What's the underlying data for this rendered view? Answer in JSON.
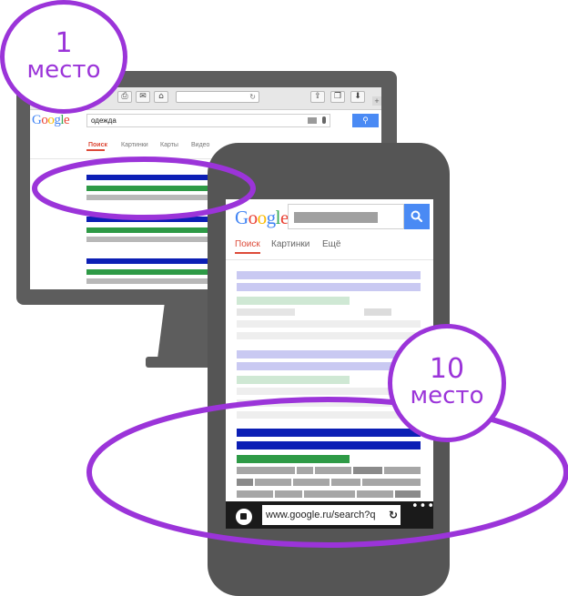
{
  "colors": {
    "accent_purple": "#9b34d9",
    "result_title": "#0c1fb5",
    "result_url": "#2e9a46",
    "search_blue": "#4a8af4",
    "device_gray": "#5d5d5d"
  },
  "desktop": {
    "logo_letters": [
      "G",
      "o",
      "o",
      "g",
      "l",
      "e"
    ],
    "logo_colors": [
      "#4285f4",
      "#ea4335",
      "#fbbc05",
      "#4285f4",
      "#34a853",
      "#ea4335"
    ],
    "query": "одежда",
    "search_icon": "search-icon",
    "toolbar_icons": [
      "printer-icon",
      "mail-icon",
      "home-icon"
    ],
    "toolbar_glyphs": [
      "⎙",
      "✉",
      "⌂"
    ],
    "right_icons": [
      "share-icon",
      "tabs-icon",
      "download-icon"
    ],
    "right_glyphs": [
      "⇪",
      "❐",
      "⬇"
    ],
    "reload_glyph": "↻",
    "plus_glyph": "+",
    "search_glyph": "⚲",
    "nav": [
      "Поиск",
      "Картинки",
      "Карты",
      "Видео"
    ]
  },
  "mobile": {
    "logo_letters": [
      "G",
      "o",
      "o",
      "g",
      "l",
      "e"
    ],
    "logo_colors": [
      "#4285f4",
      "#ea4335",
      "#fbbc05",
      "#4285f4",
      "#34a853",
      "#ea4335"
    ],
    "search_glyph": "⚲",
    "tabs": [
      "Поиск",
      "Картинки",
      "Ещё"
    ],
    "url": "www.google.ru/search?q",
    "reload_glyph": "↻",
    "menu_glyph": "•••"
  },
  "badges": {
    "first": {
      "number": "1",
      "word": "место"
    },
    "tenth": {
      "number": "10",
      "word": "место"
    }
  }
}
